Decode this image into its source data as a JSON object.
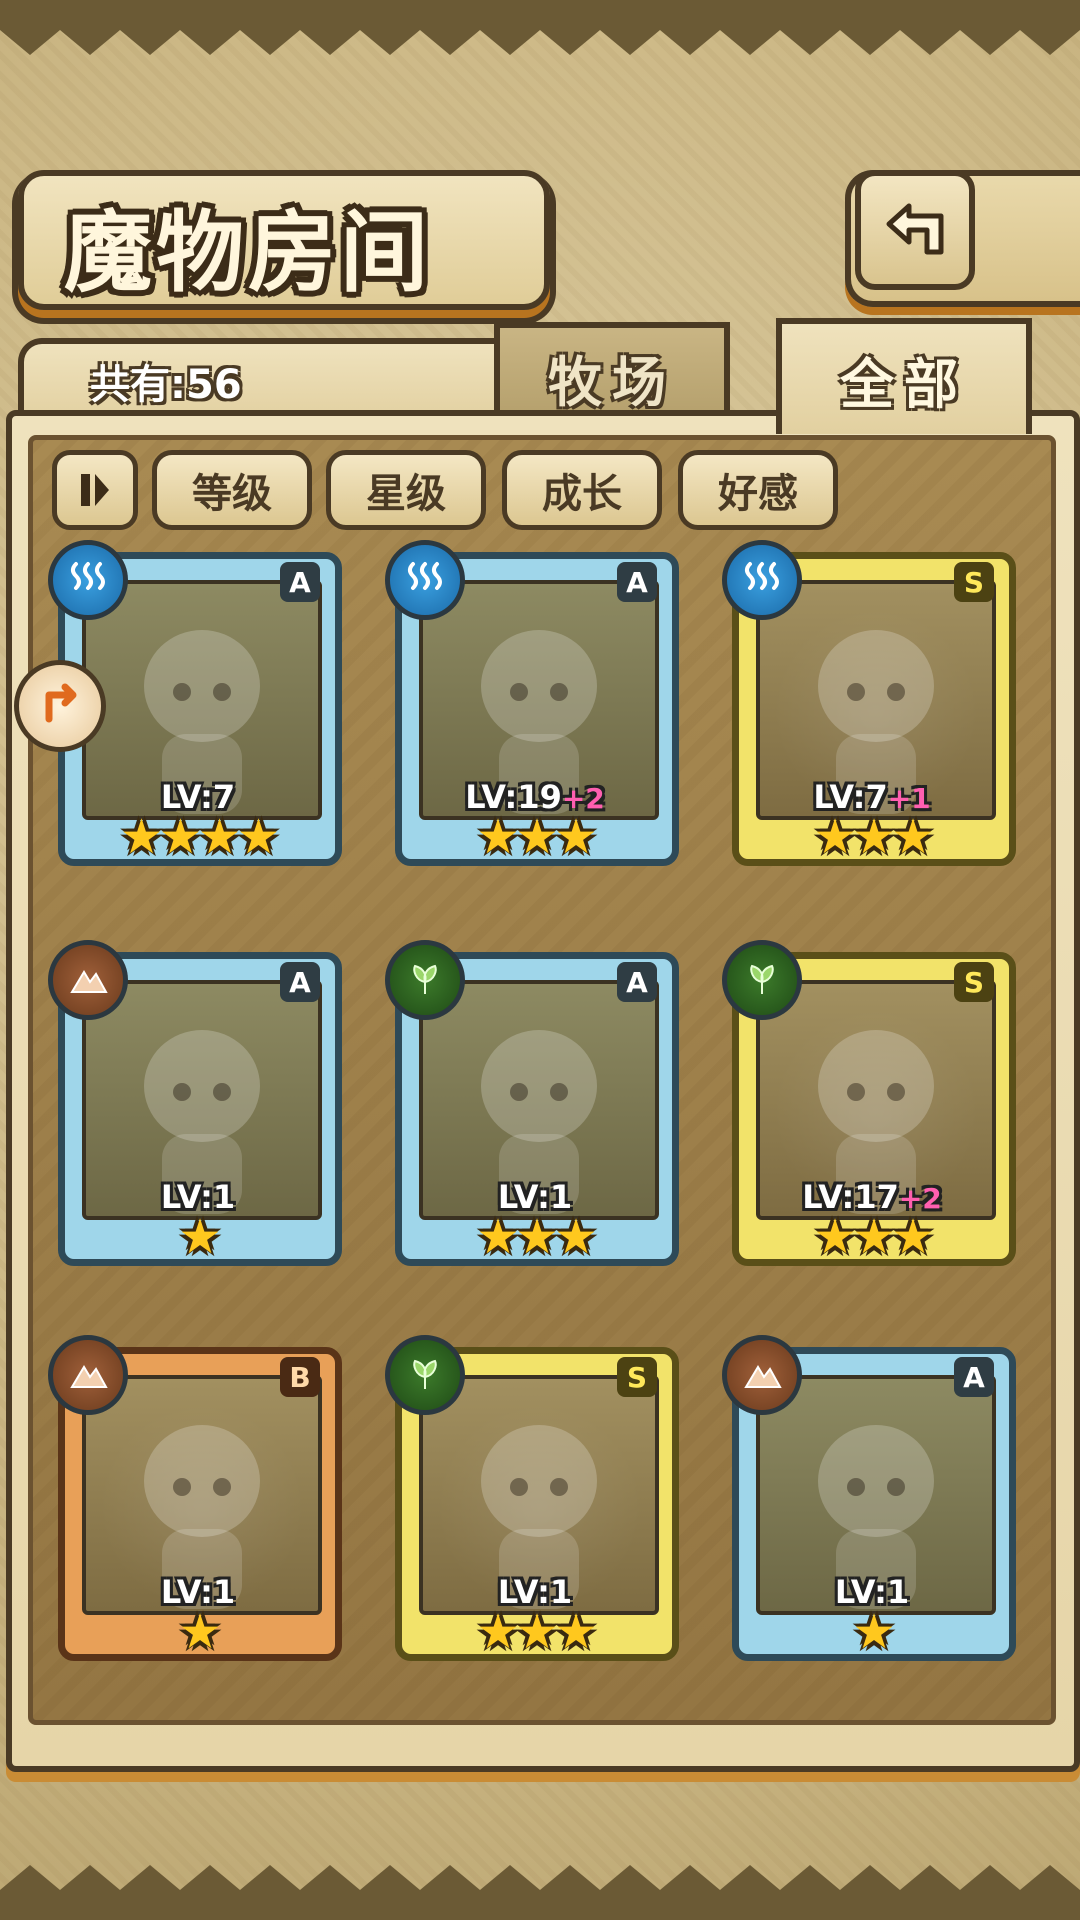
{
  "header": {
    "title": "魔物房间",
    "return_icon": "return-icon"
  },
  "summary": {
    "count_label": "共有:56"
  },
  "tabs": [
    {
      "label": "牧场",
      "active": false
    },
    {
      "label": "全部",
      "active": true
    }
  ],
  "filters": {
    "sort_icon": "pause-sort-icon",
    "buttons": [
      "等级",
      "星级",
      "成长",
      "好感"
    ]
  },
  "colors": {
    "panel": "#efe2bd",
    "outline": "#4a3a24",
    "blue_frame": "#9fd6ea",
    "gold_frame": "#f2e36a",
    "bronze_frame": "#e8a058",
    "bonus_pink": "#ff5fb0",
    "star_yellow": "#ffc81e"
  },
  "monsters": [
    {
      "element": "water",
      "rank": "A",
      "level": "LV:7",
      "bonus": "",
      "stars": "★★★★",
      "frame": "blue"
    },
    {
      "element": "water",
      "rank": "A",
      "level": "LV:19",
      "bonus": "+2",
      "stars": "★★★",
      "frame": "blue"
    },
    {
      "element": "water",
      "rank": "S",
      "level": "LV:7",
      "bonus": "+1",
      "stars": "★★★",
      "frame": "gold"
    },
    {
      "element": "earth",
      "rank": "A",
      "level": "LV:1",
      "bonus": "",
      "stars": "★",
      "frame": "blue"
    },
    {
      "element": "wood",
      "rank": "A",
      "level": "LV:1",
      "bonus": "",
      "stars": "★★★",
      "frame": "blue"
    },
    {
      "element": "wood",
      "rank": "S",
      "level": "LV:17",
      "bonus": "+2",
      "stars": "★★★",
      "frame": "gold"
    },
    {
      "element": "earth",
      "rank": "B",
      "level": "LV:1",
      "bonus": "",
      "stars": "★",
      "frame": "bronze"
    },
    {
      "element": "wood",
      "rank": "S",
      "level": "LV:1",
      "bonus": "",
      "stars": "★★★",
      "frame": "gold"
    },
    {
      "element": "earth",
      "rank": "A",
      "level": "LV:1",
      "bonus": "",
      "stars": "★",
      "frame": "blue"
    }
  ]
}
